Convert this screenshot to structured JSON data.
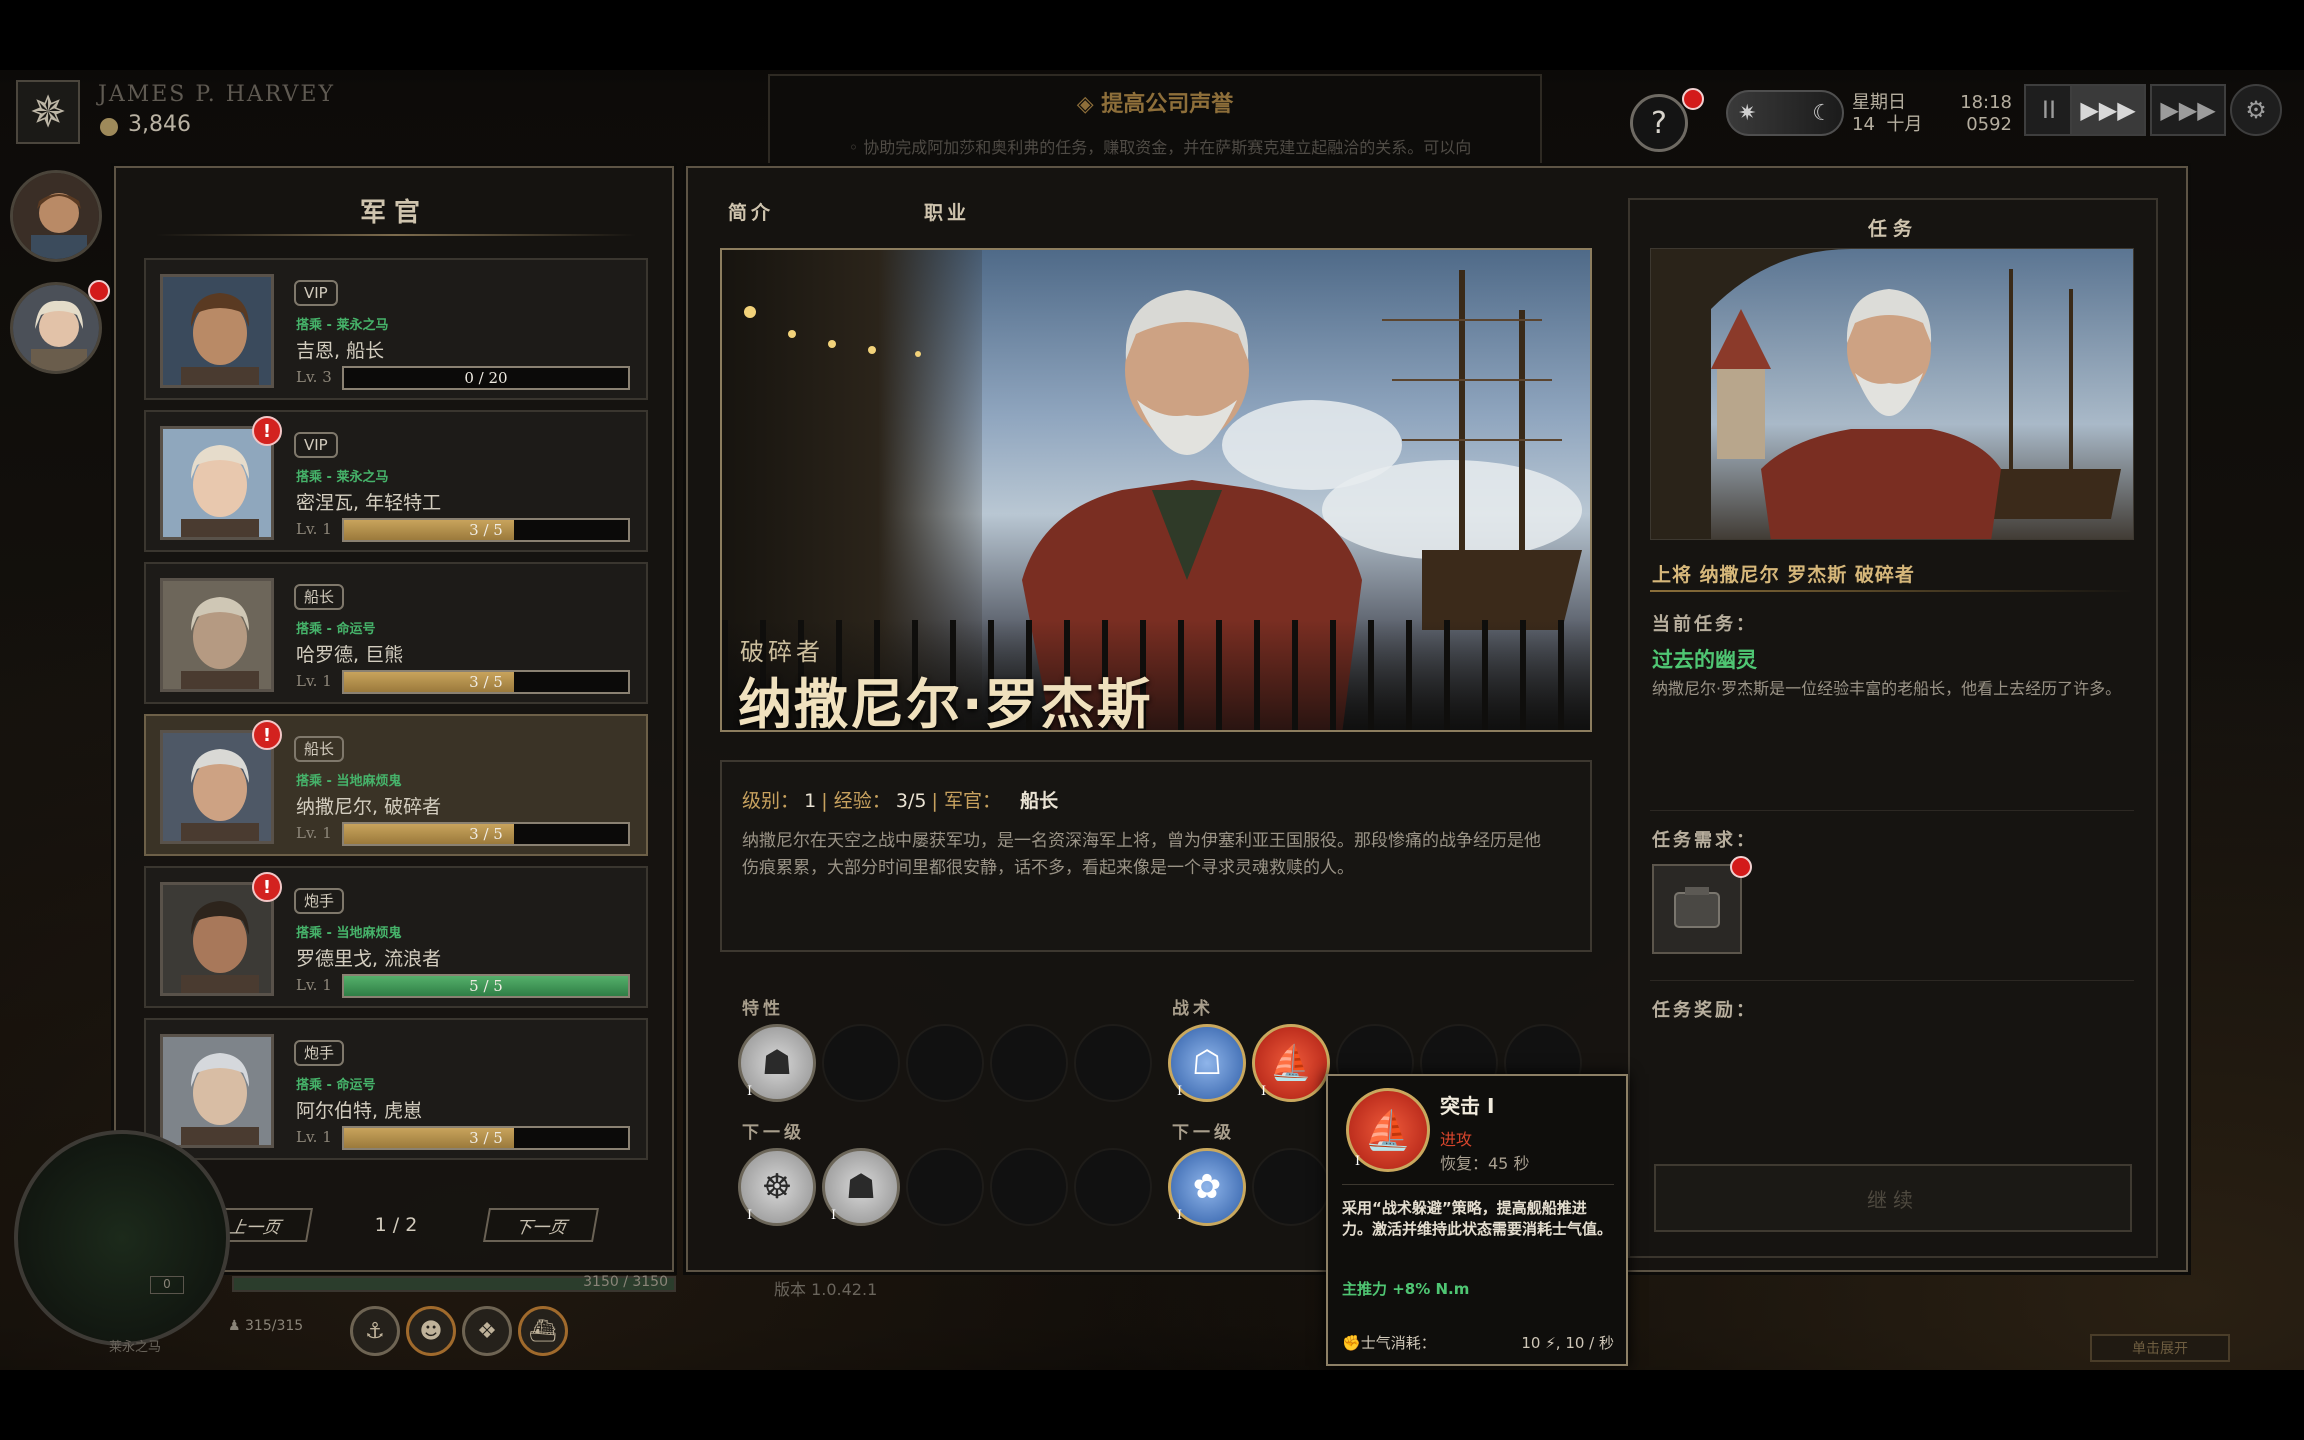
{
  "hud": {
    "player_name": "JAMES P. HARVEY",
    "coins": "3,846",
    "notice_title": "提高公司声誉",
    "notice_text": "◦ 协助完成阿加莎和奥利弗的任务，赚取资金，并在萨斯赛克建立起融洽的关系。可以向",
    "help_label": "?",
    "weekday": "星期日",
    "day": "14",
    "month": "十月",
    "time": "18:18",
    "year": "0592",
    "pause_label": "II",
    "play_label": "▶▶▶",
    "fast_label": "▶▶▶",
    "settings_icon": "gear-icon"
  },
  "left_panel": {
    "title": "军官",
    "officers": [
      {
        "tag": "VIP",
        "ship": "搭乘 - 莱永之马",
        "name": "吉恩, 船长",
        "level": "Lv. 3",
        "progress_text": "0 / 20",
        "progress": 0,
        "bar_color": "gold",
        "alert": false,
        "selected": false
      },
      {
        "tag": "VIP",
        "ship": "搭乘 - 莱永之马",
        "name": "密涅瓦, 年轻特工",
        "level": "Lv. 1",
        "progress_text": "3 / 5",
        "progress": 0.6,
        "bar_color": "gold",
        "alert": true,
        "selected": false
      },
      {
        "tag": "船长",
        "ship": "搭乘 - 命运号",
        "name": "哈罗德, 巨熊",
        "level": "Lv. 1",
        "progress_text": "3 / 5",
        "progress": 0.6,
        "bar_color": "gold",
        "alert": false,
        "selected": false
      },
      {
        "tag": "船长",
        "ship": "搭乘 - 当地麻烦鬼",
        "name": "纳撒尼尔, 破碎者",
        "level": "Lv. 1",
        "progress_text": "3 / 5",
        "progress": 0.6,
        "bar_color": "gold",
        "alert": true,
        "selected": true
      },
      {
        "tag": "炮手",
        "ship": "搭乘 - 当地麻烦鬼",
        "name": "罗德里戈, 流浪者",
        "level": "Lv. 1",
        "progress_text": "5 / 5",
        "progress": 1.0,
        "bar_color": "green",
        "alert": true,
        "selected": false
      },
      {
        "tag": "炮手",
        "ship": "搭乘 - 命运号",
        "name": "阿尔伯特, 虎崽",
        "level": "Lv. 1",
        "progress_text": "3 / 5",
        "progress": 0.6,
        "bar_color": "gold",
        "alert": false,
        "selected": false
      }
    ],
    "prev_label": "上一页",
    "next_label": "下一页",
    "page": "1 / 2"
  },
  "main": {
    "tabs": [
      "简介",
      "职业"
    ],
    "hero_subtitle": "破碎者",
    "hero_name": "纳撒尼尔·罗杰斯",
    "stats": {
      "level_label": "级别：",
      "level": "1",
      "exp_label": "经验：",
      "exp": "3/5",
      "rank_label": "军官：",
      "rank": "船长"
    },
    "description": "纳撒尼尔在天空之战中屡获军功，是一名资深海军上将，曾为伊塞利亚王国服役。那段惨痛的战争经历是他伤痕累累，大部分时间里都很安静，话不多，看起来像是一个寻求灵魂救赎的人。",
    "traits_label": "特性",
    "tactics_label": "战术",
    "next_level_label": "下一级",
    "roman_one": "I",
    "version": "版本 1.0.42.1"
  },
  "mission": {
    "header": "任务",
    "title": "上将 纳撒尼尔 罗杰斯 破碎者",
    "current_label": "当前任务：",
    "current_quest": "过去的幽灵",
    "quest_desc": "纳撒尼尔·罗杰斯是一位经验丰富的老船长，他看上去经历了许多。",
    "requirements_label": "任务需求：",
    "rewards_label": "任务奖励：",
    "continue_label": "继续"
  },
  "tooltip": {
    "name": "突击 I",
    "type": "进攻",
    "cooldown": "恢复：45 秒",
    "description": "采用“战术躲避”策略，提高舰船推进力。激活并维持此状态需要消耗士气值。",
    "bonus": "主推力 +8% N.m",
    "cost_label": "士气消耗：",
    "cost_value": "10 ⚡, 10 / 秒"
  },
  "bottom": {
    "hp_text": "3150 / 3150",
    "crew": "315/315",
    "ship_name": "莱永之马",
    "click_expand": "单击展开",
    "counter": "0"
  },
  "colors": {
    "accent_gold": "#c8a35c",
    "quest_green": "#4fc673",
    "alert_red": "#d3221f",
    "offense_red": "#d7452c"
  }
}
